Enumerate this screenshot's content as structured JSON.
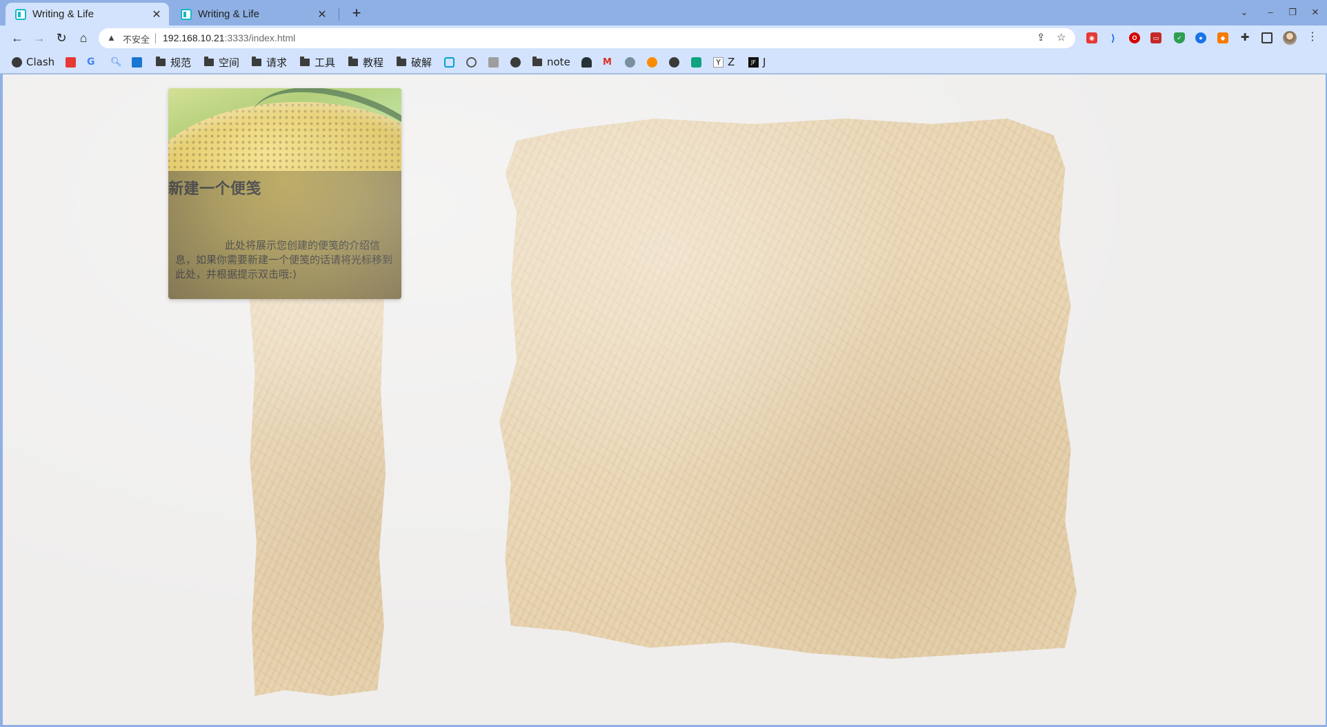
{
  "browser": {
    "tabs": [
      {
        "title": "Writing & Life",
        "active": true
      },
      {
        "title": "Writing & Life",
        "active": false
      }
    ],
    "address": {
      "security_label": "不安全",
      "url_host": "192.168.10.21",
      "url_rest": ":3333/index.html"
    },
    "bookmarks": [
      {
        "label": "Clash",
        "icon": "globe-icon"
      },
      {
        "label": "",
        "icon": "qr-icon"
      },
      {
        "label": "",
        "icon": "google-icon"
      },
      {
        "label": "",
        "icon": "search-icon"
      },
      {
        "label": "",
        "icon": "translate-icon"
      },
      {
        "label": "规范",
        "icon": "folder-icon"
      },
      {
        "label": "空间",
        "icon": "folder-icon"
      },
      {
        "label": "请求",
        "icon": "folder-icon"
      },
      {
        "label": "工具",
        "icon": "folder-icon"
      },
      {
        "label": "教程",
        "icon": "folder-icon"
      },
      {
        "label": "破解",
        "icon": "folder-icon"
      },
      {
        "label": "",
        "icon": "bilibili-icon"
      },
      {
        "label": "",
        "icon": "check-icon"
      },
      {
        "label": "",
        "icon": "doc-icon"
      },
      {
        "label": "",
        "icon": "globe-icon"
      },
      {
        "label": "note",
        "icon": "folder-icon"
      },
      {
        "label": "",
        "icon": "figure-icon"
      },
      {
        "label": "",
        "icon": "gmail-icon"
      },
      {
        "label": "",
        "icon": "bird-icon"
      },
      {
        "label": "",
        "icon": "orange-icon"
      },
      {
        "label": "",
        "icon": "globe-icon"
      },
      {
        "label": "",
        "icon": "chatgpt-icon"
      },
      {
        "label": "Z",
        "icon": "y-icon"
      },
      {
        "label": "J",
        "icon": "jf-icon"
      }
    ],
    "colors": {
      "frame": "#8fb0e4",
      "toolbar": "#d3e3fd",
      "page_bg": "#efeeed",
      "paper": "#e6d0aa"
    }
  },
  "page": {
    "note_card": {
      "title": "新建一个便笺",
      "description": "此处将展示您创建的便笺的介绍信息，如果你需要新建一个便笺的话请将光标移到此处，并根据提示双击哦:)"
    }
  }
}
